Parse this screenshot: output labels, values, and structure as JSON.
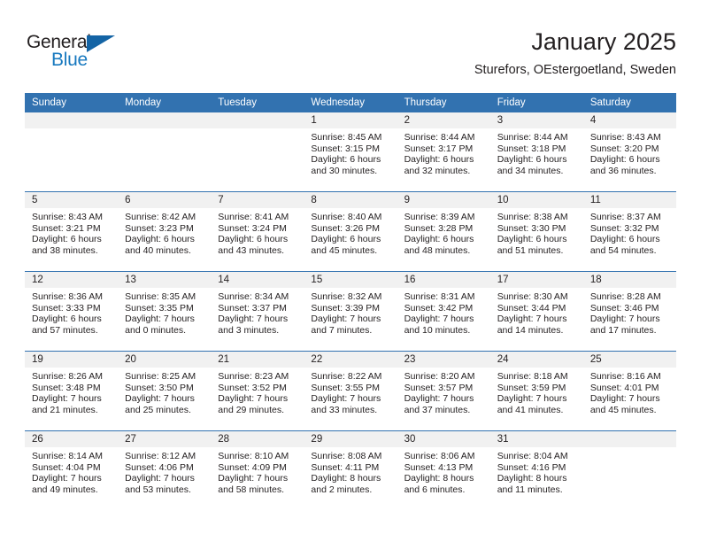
{
  "brand": {
    "logo_text_top": "General",
    "logo_text_bottom": "Blue",
    "accent_color": "#1464a5",
    "blue_text_color": "#1879bf"
  },
  "header": {
    "title": "January 2025",
    "subtitle": "Sturefors, OEstergoetland, Sweden"
  },
  "calendar": {
    "header_background": "#3272b0",
    "daynum_background": "#f1f1f1",
    "weekday_headers": [
      "Sunday",
      "Monday",
      "Tuesday",
      "Wednesday",
      "Thursday",
      "Friday",
      "Saturday"
    ],
    "weeks": [
      [
        {
          "day": "",
          "lines": []
        },
        {
          "day": "",
          "lines": []
        },
        {
          "day": "",
          "lines": []
        },
        {
          "day": "1",
          "lines": [
            "Sunrise: 8:45 AM",
            "Sunset: 3:15 PM",
            "Daylight: 6 hours",
            "and 30 minutes."
          ]
        },
        {
          "day": "2",
          "lines": [
            "Sunrise: 8:44 AM",
            "Sunset: 3:17 PM",
            "Daylight: 6 hours",
            "and 32 minutes."
          ]
        },
        {
          "day": "3",
          "lines": [
            "Sunrise: 8:44 AM",
            "Sunset: 3:18 PM",
            "Daylight: 6 hours",
            "and 34 minutes."
          ]
        },
        {
          "day": "4",
          "lines": [
            "Sunrise: 8:43 AM",
            "Sunset: 3:20 PM",
            "Daylight: 6 hours",
            "and 36 minutes."
          ]
        }
      ],
      [
        {
          "day": "5",
          "lines": [
            "Sunrise: 8:43 AM",
            "Sunset: 3:21 PM",
            "Daylight: 6 hours",
            "and 38 minutes."
          ]
        },
        {
          "day": "6",
          "lines": [
            "Sunrise: 8:42 AM",
            "Sunset: 3:23 PM",
            "Daylight: 6 hours",
            "and 40 minutes."
          ]
        },
        {
          "day": "7",
          "lines": [
            "Sunrise: 8:41 AM",
            "Sunset: 3:24 PM",
            "Daylight: 6 hours",
            "and 43 minutes."
          ]
        },
        {
          "day": "8",
          "lines": [
            "Sunrise: 8:40 AM",
            "Sunset: 3:26 PM",
            "Daylight: 6 hours",
            "and 45 minutes."
          ]
        },
        {
          "day": "9",
          "lines": [
            "Sunrise: 8:39 AM",
            "Sunset: 3:28 PM",
            "Daylight: 6 hours",
            "and 48 minutes."
          ]
        },
        {
          "day": "10",
          "lines": [
            "Sunrise: 8:38 AM",
            "Sunset: 3:30 PM",
            "Daylight: 6 hours",
            "and 51 minutes."
          ]
        },
        {
          "day": "11",
          "lines": [
            "Sunrise: 8:37 AM",
            "Sunset: 3:32 PM",
            "Daylight: 6 hours",
            "and 54 minutes."
          ]
        }
      ],
      [
        {
          "day": "12",
          "lines": [
            "Sunrise: 8:36 AM",
            "Sunset: 3:33 PM",
            "Daylight: 6 hours",
            "and 57 minutes."
          ]
        },
        {
          "day": "13",
          "lines": [
            "Sunrise: 8:35 AM",
            "Sunset: 3:35 PM",
            "Daylight: 7 hours",
            "and 0 minutes."
          ]
        },
        {
          "day": "14",
          "lines": [
            "Sunrise: 8:34 AM",
            "Sunset: 3:37 PM",
            "Daylight: 7 hours",
            "and 3 minutes."
          ]
        },
        {
          "day": "15",
          "lines": [
            "Sunrise: 8:32 AM",
            "Sunset: 3:39 PM",
            "Daylight: 7 hours",
            "and 7 minutes."
          ]
        },
        {
          "day": "16",
          "lines": [
            "Sunrise: 8:31 AM",
            "Sunset: 3:42 PM",
            "Daylight: 7 hours",
            "and 10 minutes."
          ]
        },
        {
          "day": "17",
          "lines": [
            "Sunrise: 8:30 AM",
            "Sunset: 3:44 PM",
            "Daylight: 7 hours",
            "and 14 minutes."
          ]
        },
        {
          "day": "18",
          "lines": [
            "Sunrise: 8:28 AM",
            "Sunset: 3:46 PM",
            "Daylight: 7 hours",
            "and 17 minutes."
          ]
        }
      ],
      [
        {
          "day": "19",
          "lines": [
            "Sunrise: 8:26 AM",
            "Sunset: 3:48 PM",
            "Daylight: 7 hours",
            "and 21 minutes."
          ]
        },
        {
          "day": "20",
          "lines": [
            "Sunrise: 8:25 AM",
            "Sunset: 3:50 PM",
            "Daylight: 7 hours",
            "and 25 minutes."
          ]
        },
        {
          "day": "21",
          "lines": [
            "Sunrise: 8:23 AM",
            "Sunset: 3:52 PM",
            "Daylight: 7 hours",
            "and 29 minutes."
          ]
        },
        {
          "day": "22",
          "lines": [
            "Sunrise: 8:22 AM",
            "Sunset: 3:55 PM",
            "Daylight: 7 hours",
            "and 33 minutes."
          ]
        },
        {
          "day": "23",
          "lines": [
            "Sunrise: 8:20 AM",
            "Sunset: 3:57 PM",
            "Daylight: 7 hours",
            "and 37 minutes."
          ]
        },
        {
          "day": "24",
          "lines": [
            "Sunrise: 8:18 AM",
            "Sunset: 3:59 PM",
            "Daylight: 7 hours",
            "and 41 minutes."
          ]
        },
        {
          "day": "25",
          "lines": [
            "Sunrise: 8:16 AM",
            "Sunset: 4:01 PM",
            "Daylight: 7 hours",
            "and 45 minutes."
          ]
        }
      ],
      [
        {
          "day": "26",
          "lines": [
            "Sunrise: 8:14 AM",
            "Sunset: 4:04 PM",
            "Daylight: 7 hours",
            "and 49 minutes."
          ]
        },
        {
          "day": "27",
          "lines": [
            "Sunrise: 8:12 AM",
            "Sunset: 4:06 PM",
            "Daylight: 7 hours",
            "and 53 minutes."
          ]
        },
        {
          "day": "28",
          "lines": [
            "Sunrise: 8:10 AM",
            "Sunset: 4:09 PM",
            "Daylight: 7 hours",
            "and 58 minutes."
          ]
        },
        {
          "day": "29",
          "lines": [
            "Sunrise: 8:08 AM",
            "Sunset: 4:11 PM",
            "Daylight: 8 hours",
            "and 2 minutes."
          ]
        },
        {
          "day": "30",
          "lines": [
            "Sunrise: 8:06 AM",
            "Sunset: 4:13 PM",
            "Daylight: 8 hours",
            "and 6 minutes."
          ]
        },
        {
          "day": "31",
          "lines": [
            "Sunrise: 8:04 AM",
            "Sunset: 4:16 PM",
            "Daylight: 8 hours",
            "and 11 minutes."
          ]
        },
        {
          "day": "",
          "lines": []
        }
      ]
    ]
  }
}
